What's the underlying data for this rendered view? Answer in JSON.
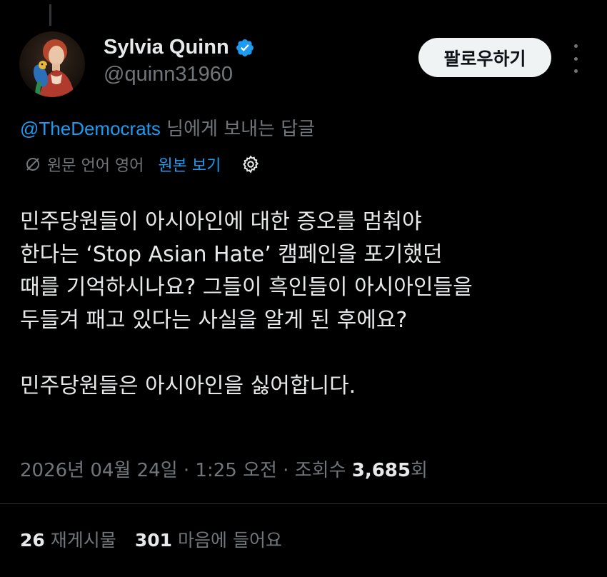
{
  "author": {
    "display_name": "Sylvia Quinn",
    "handle": "@quinn31960",
    "verified": true,
    "avatar_icon": "portrait-avatar"
  },
  "actions": {
    "follow_label": "팔로우하기",
    "more_icon": "more-dots-icon"
  },
  "reply_context": {
    "mention": "@TheDemocrats",
    "suffix": " 님에게 보내는 답글"
  },
  "translation": {
    "label": "원문 언어 영어",
    "show_original": "원본 보기",
    "settings_icon": "gear-icon"
  },
  "tweet": {
    "lines": [
      "민주당원들이 아시아인에 대한 증오를 멈춰야",
      "한다는 ‘Stop Asian Hate’ 캠페인을 포기했던",
      "때를 기억하시나요? 그들이 흑인들이 아시아인들을",
      "두들겨 패고 있다는 사실을 알게 된 후에요?"
    ],
    "second_paragraph": "민주당원들은 아시아인을 싫어합니다."
  },
  "meta": {
    "timestamp": "2026년 04월 24일 · 1:25 오전 · 조회수 ",
    "views": "3,685",
    "views_suffix": "회"
  },
  "stats": {
    "reposts_count": "26",
    "reposts_label": "재게시물",
    "likes_count": "301",
    "likes_label": "마음에 들어요"
  },
  "colors": {
    "background": "#000000",
    "text": "#e7e9ea",
    "muted": "#71767b",
    "link": "#1d9bf0",
    "verified_badge": "#1d9bf0",
    "follow_bg": "#eff3f4"
  }
}
